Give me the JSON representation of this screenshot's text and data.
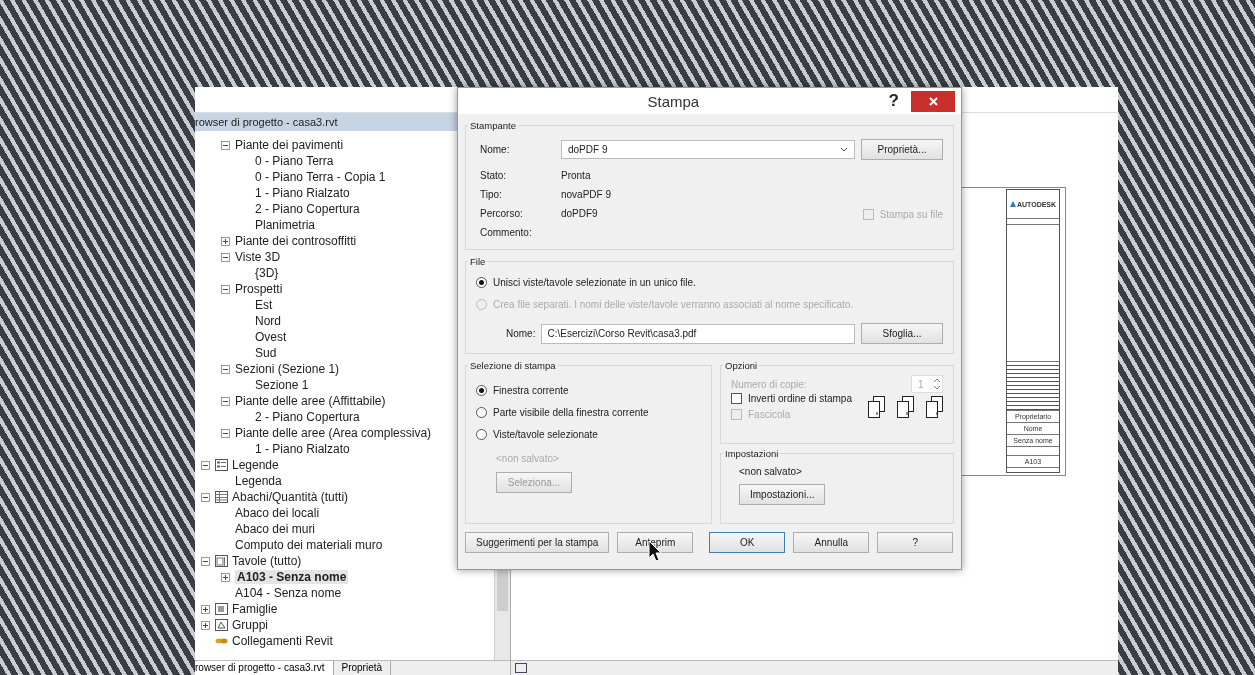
{
  "browser": {
    "title": "rowser di progetto - casa3.rvt",
    "tree": [
      {
        "children": [
          {
            "label": "Piante dei pavimenti",
            "expanded": true,
            "children": [
              {
                "label": "0 - Piano Terra"
              },
              {
                "label": "0 - Piano Terra - Copia 1"
              },
              {
                "label": "1 - Piano Rialzato"
              },
              {
                "label": "2 - Piano Copertura"
              },
              {
                "label": "Planimetria"
              }
            ]
          },
          {
            "label": "Piante dei controsoffitti",
            "expanded": false
          },
          {
            "label": "Viste 3D",
            "expanded": true,
            "children": [
              {
                "label": "{3D}"
              }
            ]
          },
          {
            "label": "Prospetti",
            "expanded": true,
            "children": [
              {
                "label": "Est"
              },
              {
                "label": "Nord"
              },
              {
                "label": "Ovest"
              },
              {
                "label": "Sud"
              }
            ]
          },
          {
            "label": "Sezioni (Sezione 1)",
            "expanded": true,
            "children": [
              {
                "label": "Sezione 1"
              }
            ]
          },
          {
            "label": "Piante delle aree (Affittabile)",
            "expanded": true,
            "children": [
              {
                "label": "2 - Piano Copertura"
              }
            ]
          },
          {
            "label": "Piante delle aree (Area complessiva)",
            "expanded": true,
            "children": [
              {
                "label": "1 - Piano Rialzato"
              }
            ]
          }
        ]
      },
      {
        "label": "Legende",
        "expanded": true,
        "kind": "legend",
        "children": [
          {
            "label": "Legenda"
          }
        ]
      },
      {
        "label": "Abachi/Quantità (tutti)",
        "expanded": true,
        "kind": "schedule",
        "children": [
          {
            "label": "Abaco dei locali"
          },
          {
            "label": "Abaco dei muri"
          },
          {
            "label": "Computo dei materiali muro"
          }
        ]
      },
      {
        "label": "Tavole (tutto)",
        "expanded": true,
        "kind": "sheets",
        "children": [
          {
            "label": "A103 - Senza nome",
            "expanded": false,
            "selected": true
          },
          {
            "label": "A104 - Senza nome",
            "selected": false
          }
        ]
      },
      {
        "label": "Famiglie",
        "expanded": false,
        "kind": "families"
      },
      {
        "label": "Gruppi",
        "expanded": false,
        "kind": "groups"
      },
      {
        "label": "Collegamenti Revit",
        "kind": "links"
      }
    ],
    "tabs": [
      {
        "label": "rowser di progetto - casa3.rvt",
        "selected": true
      },
      {
        "label": "Proprietà",
        "selected": false
      }
    ]
  },
  "sheet": {
    "logo": "AUTODESK",
    "owner": "Proprietario",
    "name_label": "Nome",
    "name": "Senza nome",
    "number": "A103"
  },
  "dialog": {
    "title": "Stampa",
    "help": "?",
    "printer": {
      "legend": "Stampante",
      "name_label": "Nome:",
      "name_value": "doPDF 9",
      "properties_button": "Proprietà...",
      "info": [
        {
          "label": "Stato:",
          "value": "Pronta"
        },
        {
          "label": "Tipo:",
          "value": "novaPDF 9"
        },
        {
          "label": "Percorso:",
          "value": "doPDF9"
        },
        {
          "label": "Commento:"
        }
      ],
      "print_to_file": {
        "label": "Stampa su file",
        "checked": false,
        "disabled": true
      }
    },
    "file": {
      "legend": "File",
      "options": [
        {
          "label": "Unisci viste/tavole selezionate in un unico file.",
          "selected": true,
          "disabled": false
        },
        {
          "label": "Crea file separati. I nomi delle viste/tavole verranno associati al nome specificato.",
          "selected": false,
          "disabled": true
        }
      ],
      "name_label": "Nome:",
      "name_value": "C:\\Esercizi\\Corso Revit\\casa3.pdf",
      "browse_button": "Sfoglia..."
    },
    "range": {
      "legend": "Selezione di stampa",
      "options": [
        {
          "label": "Finestra corrente",
          "selected": true
        },
        {
          "label": "Parte visibile della finestra corrente",
          "selected": false
        },
        {
          "label": "Viste/tavole selezionate",
          "selected": false
        }
      ],
      "saved": "<non salvato>",
      "select_button": "Seleziona...",
      "select_disabled": true
    },
    "options": {
      "legend": "Opzioni",
      "copies_label": "Numero di copie:",
      "copies_value": "1",
      "copies_disabled": true,
      "reverse": {
        "label": "Inverti ordine di stampa",
        "checked": false,
        "disabled": false
      },
      "collate": {
        "label": "Fascicola",
        "checked": false,
        "disabled": true
      }
    },
    "settings": {
      "legend": "Impostazioni",
      "value": "<non salvato>",
      "button": "Impostazioni..."
    },
    "buttons": [
      {
        "label": "Suggerimenti per la stampa",
        "default": false
      },
      {
        "label": "Anteprim",
        "default": false
      },
      {
        "label": "OK",
        "default": true
      },
      {
        "label": "Annulla",
        "default": false
      },
      {
        "label": "?",
        "default": false
      }
    ]
  }
}
